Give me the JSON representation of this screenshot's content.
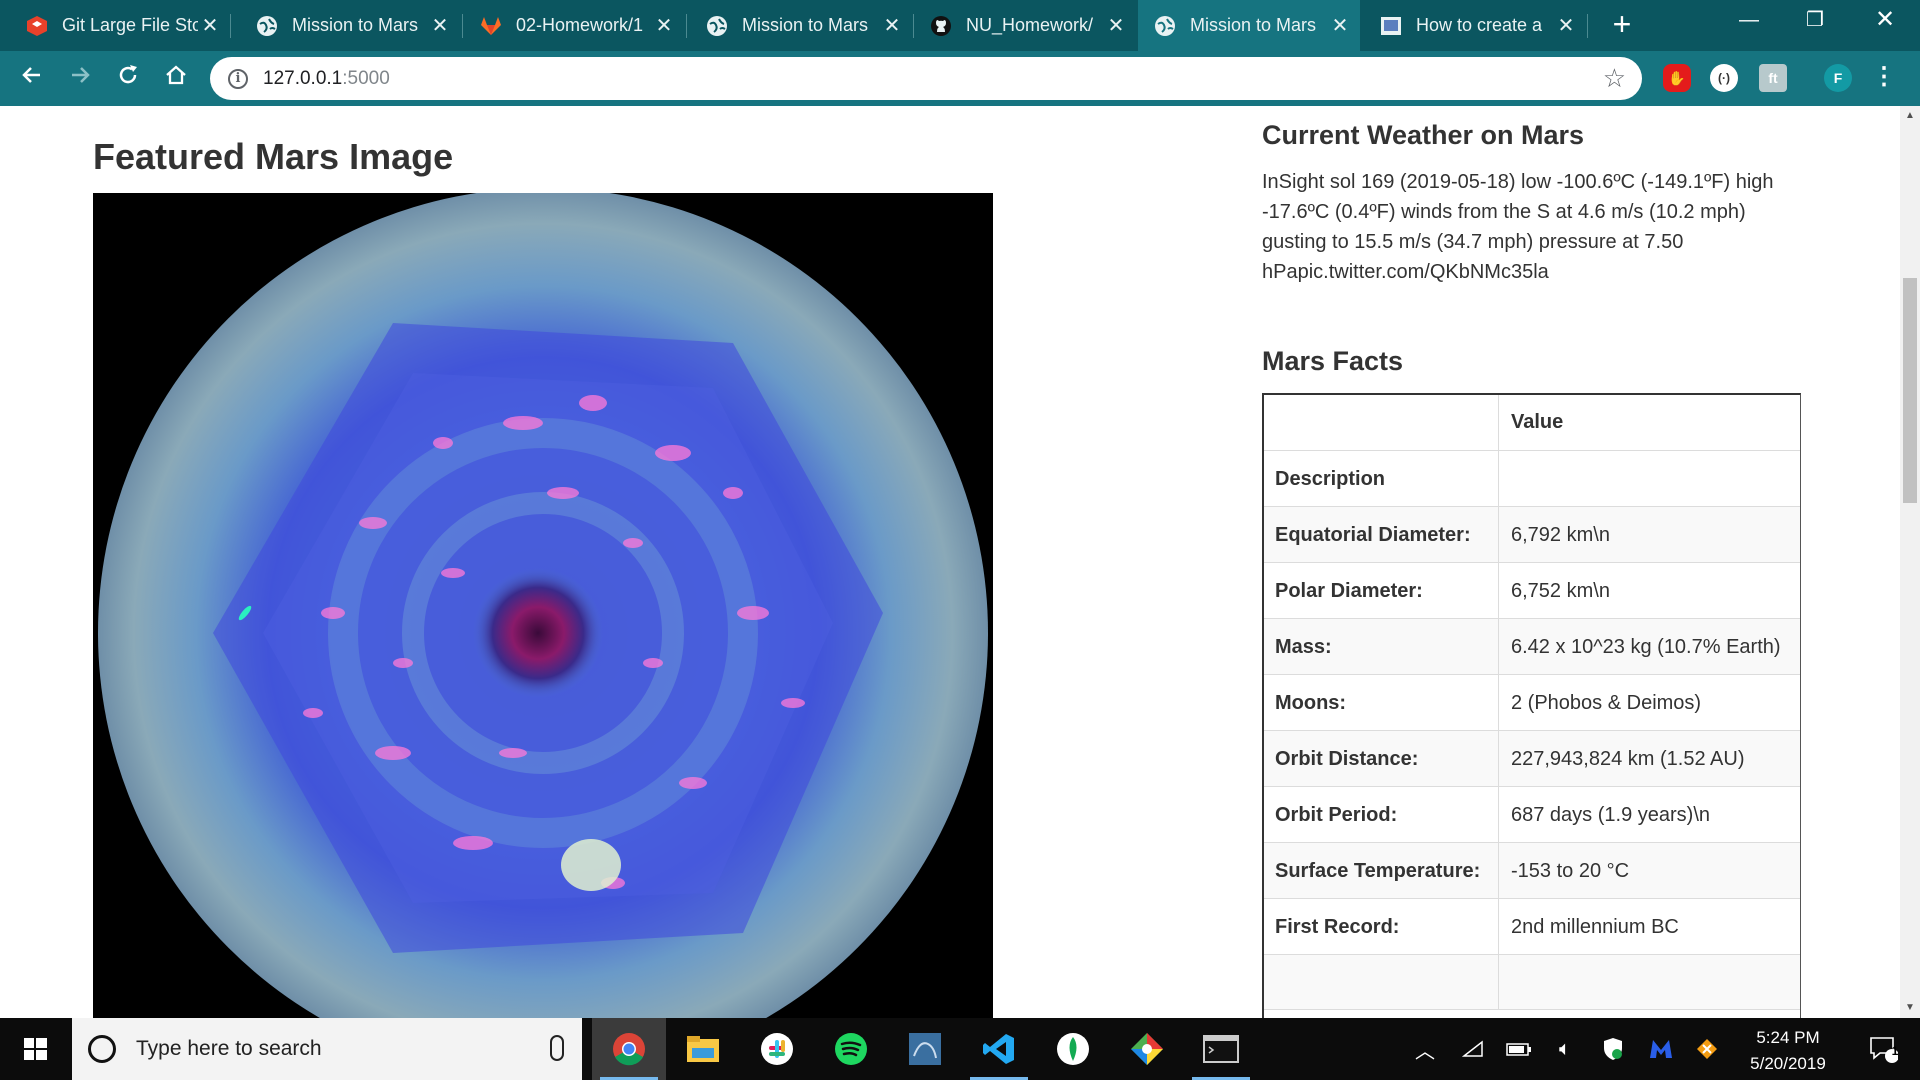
{
  "browser": {
    "tabs": [
      {
        "label": "Git Large File Sto",
        "icon": "git-lfs-icon",
        "active": false
      },
      {
        "label": "Mission to Mars",
        "icon": "globe-icon",
        "active": false
      },
      {
        "label": "02-Homework/1",
        "icon": "gitlab-icon",
        "active": false
      },
      {
        "label": "Mission to Mars",
        "icon": "globe-icon",
        "active": false
      },
      {
        "label": "NU_Homework/",
        "icon": "github-icon",
        "active": false
      },
      {
        "label": "Mission to Mars",
        "icon": "globe-icon",
        "active": true
      },
      {
        "label": "How to create a",
        "icon": "page-icon",
        "active": false
      }
    ],
    "url_host": "127.0.0.1",
    "url_port": ":5000",
    "profile_initial": "F"
  },
  "page": {
    "featured_title": "Featured Mars Image",
    "weather_title": "Current Weather on Mars",
    "weather_text": "InSight sol 169 (2019-05-18) low -100.6ºC (-149.1ºF) high -17.6ºC (0.4ºF) winds from the S at 4.6 m/s (10.2 mph) gusting to 15.5 m/s (34.7 mph) pressure at 7.50 hPapic.twitter.com/QKbNMc35la",
    "facts_title": "Mars Facts",
    "facts_header": {
      "key": "",
      "value": "Value"
    },
    "facts_rows": [
      {
        "key": "Description",
        "value": ""
      },
      {
        "key": "Equatorial Diameter:",
        "value": "6,792 km\\n"
      },
      {
        "key": "Polar Diameter:",
        "value": "6,752 km\\n"
      },
      {
        "key": "Mass:",
        "value": "6.42 x 10^23 kg (10.7% Earth)"
      },
      {
        "key": "Moons:",
        "value": "2 (Phobos & Deimos)"
      },
      {
        "key": "Orbit Distance:",
        "value": "227,943,824 km (1.52 AU)"
      },
      {
        "key": "Orbit Period:",
        "value": "687 days (1.9 years)\\n"
      },
      {
        "key": "Surface Temperature:",
        "value": "-153 to 20 °C"
      },
      {
        "key": "First Record:",
        "value": "2nd millennium BC"
      }
    ]
  },
  "taskbar": {
    "search_placeholder": "Type here to search",
    "apps": [
      "chrome-icon",
      "file-explorer-icon",
      "slack-icon",
      "spotify-icon",
      "mysql-workbench-icon",
      "vscode-icon",
      "mongodb-compass-icon",
      "git-kraken-icon",
      "terminal-icon"
    ],
    "time": "5:24 PM",
    "date": "5/20/2019",
    "notification_count": "1"
  },
  "colors": {
    "tabstrip": "#0b5660",
    "toolbar": "#167480",
    "taskbar": "#0c0c0c"
  }
}
